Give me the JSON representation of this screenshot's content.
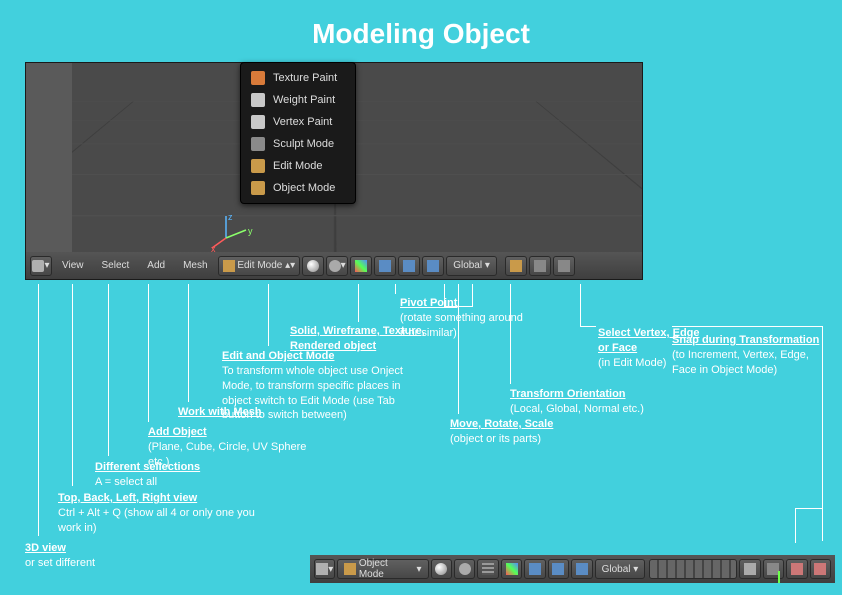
{
  "title": "Modeling Object",
  "dropdown": {
    "items": [
      {
        "label": "Texture Paint",
        "icon": "#d97b3a"
      },
      {
        "label": "Weight Paint",
        "icon": "#c8c8c8"
      },
      {
        "label": "Vertex Paint",
        "icon": "#c8c8c8"
      },
      {
        "label": "Sculpt Mode",
        "icon": "#8a8a8a"
      },
      {
        "label": "Edit Mode",
        "icon": "#c99a4a"
      },
      {
        "label": "Object Mode",
        "icon": "#c99a4a"
      }
    ]
  },
  "header": {
    "view": "View",
    "select": "Select",
    "add": "Add",
    "mesh": "Mesh",
    "mode": "Edit Mode",
    "orient": "Global"
  },
  "bottom": {
    "mode": "Object Mode",
    "orient": "Global"
  },
  "axis": {
    "x": "x",
    "y": "y",
    "z": "z"
  },
  "annotations": {
    "a1": {
      "h": "3D view",
      "s": "or set different"
    },
    "a2": {
      "h": "Top, Back, Left, Right view",
      "s": "Ctrl + Alt + Q (show all 4 or only one you work in)"
    },
    "a3": {
      "h": "Different sellections",
      "s": "A = select all"
    },
    "a4": {
      "h": "Add Object",
      "s": "(Plane, Cube, Circle, UV Sphere etc.)"
    },
    "a5": {
      "h": "Work with Mesh",
      "s": ""
    },
    "a6": {
      "h": "Edit and Object Mode",
      "s": "To transform whole object use Onject Mode, to transform specific places in object switch to Edit Mode (use Tab button to switch between)"
    },
    "a7": {
      "h": "Solid, Wireframe, Texture, Rendered object",
      "s": ""
    },
    "a8": {
      "h": "Pivot Point",
      "s": "(rotate something around it or similar)"
    },
    "a9": {
      "h": "Move, Rotate, Scale",
      "s": "(object or its parts)"
    },
    "a10": {
      "h": "Transform Orientation",
      "s": "(Local, Global, Normal etc.)"
    },
    "a11": {
      "h": "Select Vertex, Edge or Face",
      "s": "(in Edit Mode)"
    },
    "a12": {
      "h": "Snap during Transformation",
      "s": "(to Increment, Vertex, Edge, Face in Object Mode)"
    }
  }
}
